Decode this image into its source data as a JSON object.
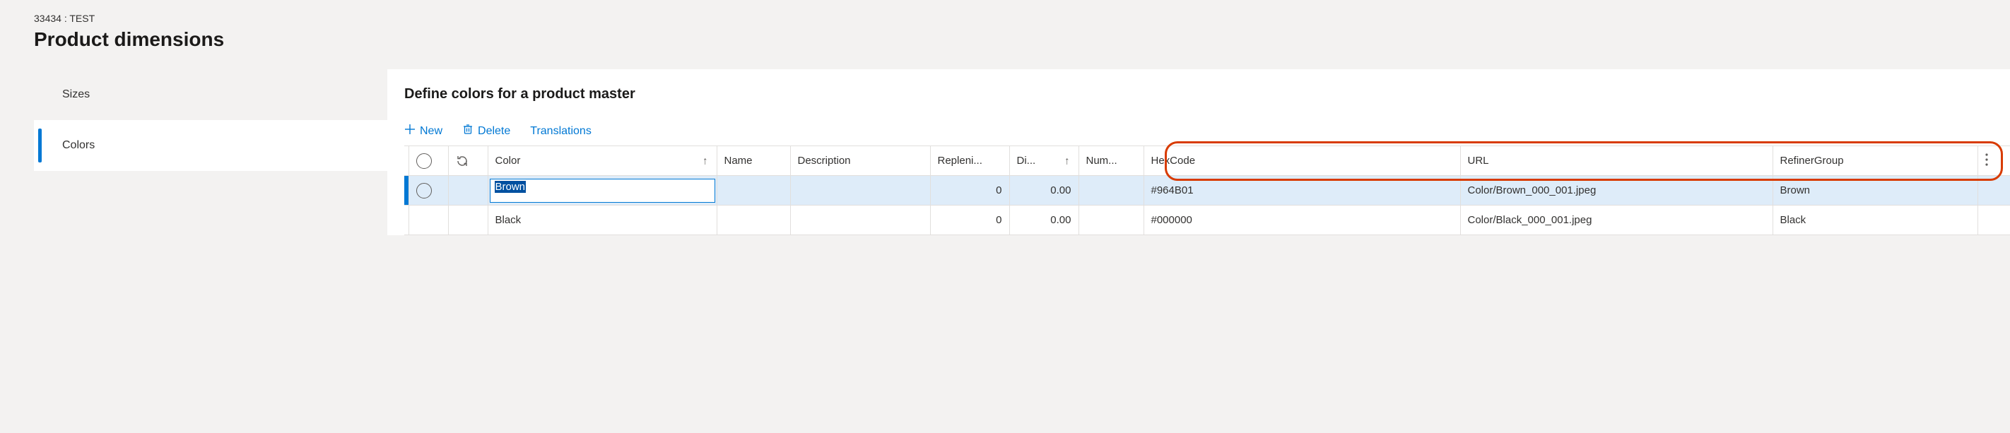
{
  "header": {
    "breadcrumb": "33434 : TEST",
    "title": "Product dimensions"
  },
  "sidebar": {
    "items": [
      {
        "label": "Sizes",
        "active": false
      },
      {
        "label": "Colors",
        "active": true
      }
    ]
  },
  "main": {
    "section_title": "Define colors for a product master",
    "toolbar": {
      "new_label": "New",
      "delete_label": "Delete",
      "translations_label": "Translations"
    },
    "grid": {
      "columns": {
        "color": "Color",
        "name": "Name",
        "description": "Description",
        "replenish": "Repleni...",
        "di": "Di...",
        "num": "Num...",
        "hexcode": "HexCode",
        "url": "URL",
        "refiner": "RefinerGroup"
      },
      "rows": [
        {
          "selected": true,
          "editing": true,
          "color": "Brown",
          "name": "",
          "description": "",
          "replenish": "0",
          "di": "0.00",
          "num": "",
          "hexcode": "#964B01",
          "url": "Color/Brown_000_001.jpeg",
          "refiner": "Brown"
        },
        {
          "selected": false,
          "editing": false,
          "color": "Black",
          "name": "",
          "description": "",
          "replenish": "0",
          "di": "0.00",
          "num": "",
          "hexcode": "#000000",
          "url": "Color/Black_000_001.jpeg",
          "refiner": "Black"
        }
      ]
    }
  }
}
